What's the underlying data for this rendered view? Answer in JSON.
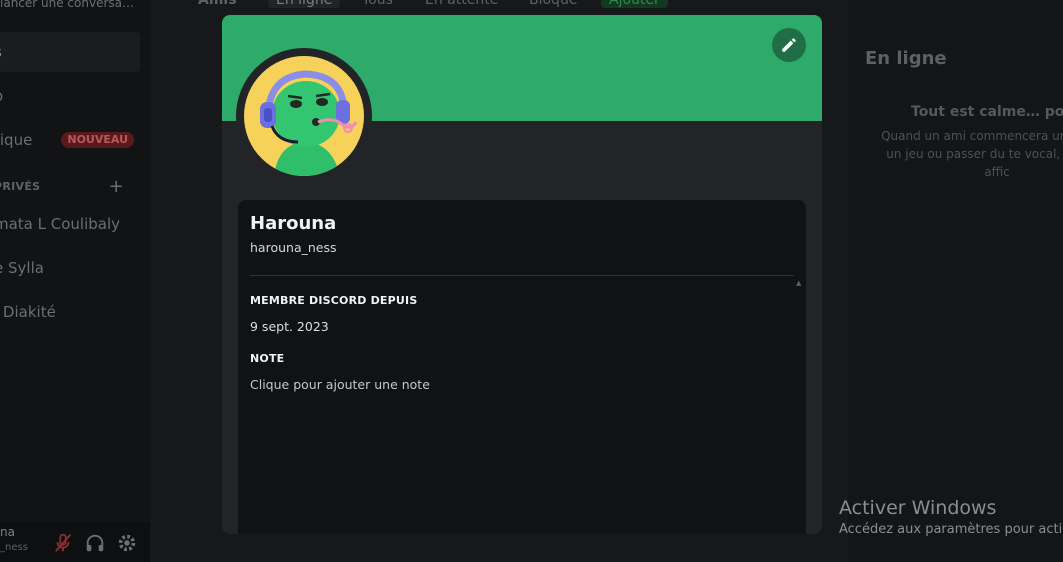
{
  "sidebar": {
    "top_text": "lancer une conversa…",
    "items": [
      {
        "label": "s",
        "active": true
      },
      {
        "label": "o"
      },
      {
        "label": "tique",
        "badge": "NOUVEAU"
      }
    ],
    "section_label": "PRIVÉS",
    "section_add": "+",
    "dms": [
      "mata L Coulibaly",
      "e Sylla",
      "l Diakité"
    ],
    "user": {
      "name": "na",
      "tag": "_ness"
    }
  },
  "topnav": {
    "items": [
      "Amis",
      "En ligne",
      "Tous",
      "En attente",
      "Bloqué",
      "Ajouter"
    ]
  },
  "right_panel": {
    "title": "En ligne",
    "empty_title": "Tout est calme… pour",
    "empty_text": "Quand un ami commencera un jouer à un jeu ou passer du te vocal, ce sera affic"
  },
  "watermark": {
    "title": "Activer Windows",
    "subtitle": "Accédez aux paramètres pour acti"
  },
  "profile": {
    "banner_color": "#2eab6a",
    "display_name": "Harouna",
    "username": "harouna_ness",
    "member_since_label": "MEMBRE DISCORD DEPUIS",
    "member_since": "9 sept. 2023",
    "note_label": "NOTE",
    "note_placeholder": "Clique pour ajouter une note"
  }
}
